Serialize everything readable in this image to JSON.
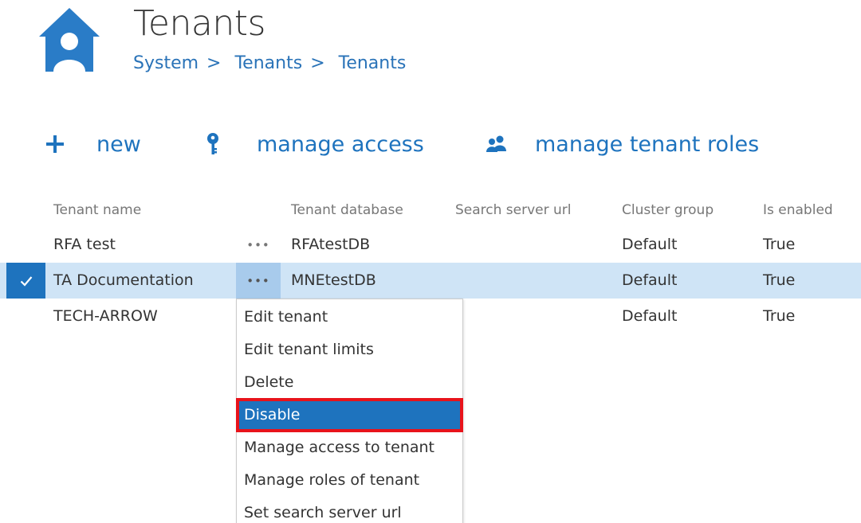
{
  "header": {
    "title": "Tenants",
    "breadcrumb": [
      "System",
      "Tenants",
      "Tenants"
    ],
    "separator": ">"
  },
  "toolbar": {
    "new_label": "new",
    "manage_access_label": "manage access",
    "manage_roles_label": "manage tenant roles"
  },
  "table": {
    "columns": [
      "Tenant name",
      "Tenant database",
      "Search server url",
      "Cluster group",
      "Is enabled"
    ],
    "rows": [
      {
        "name": "RFA test",
        "database": "RFAtestDB",
        "search_url": "",
        "cluster": "Default",
        "enabled": "True",
        "selected": false
      },
      {
        "name": "TA Documentation",
        "database": "MNEtestDB",
        "search_url": "",
        "cluster": "Default",
        "enabled": "True",
        "selected": true
      },
      {
        "name": "TECH-ARROW",
        "database": "",
        "search_url": "",
        "cluster": "Default",
        "enabled": "True",
        "selected": false
      }
    ],
    "more_glyph": "•••"
  },
  "context_menu": {
    "items": [
      "Edit tenant",
      "Edit tenant limits",
      "Delete",
      "Disable",
      "Manage access to tenant",
      "Manage roles of tenant",
      "Set search server url"
    ],
    "highlighted": "Disable"
  },
  "colors": {
    "accent": "#1e73be",
    "selected_row": "#cfe4f6",
    "highlight_border": "#e8131b"
  }
}
